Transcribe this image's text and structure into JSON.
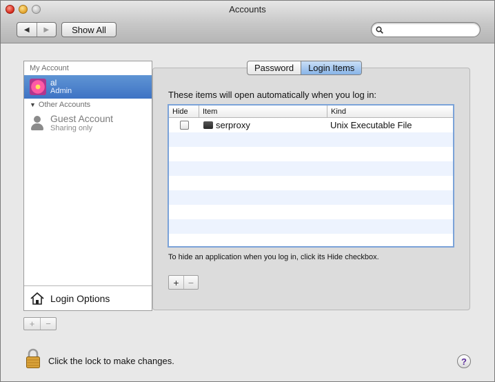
{
  "window": {
    "title": "Accounts"
  },
  "toolbar": {
    "back_glyph": "◀",
    "forward_glyph": "▶",
    "show_all_label": "Show All",
    "search_value": ""
  },
  "sidebar": {
    "my_account_header": "My Account",
    "my_account": {
      "name": "al",
      "role": "Admin"
    },
    "other_accounts_header": "Other Accounts",
    "other_accounts": [
      {
        "name": "Guest Account",
        "role": "Sharing only"
      }
    ],
    "login_options_label": "Login Options",
    "add_glyph": "+",
    "remove_glyph": "−"
  },
  "tabs": [
    {
      "label": "Password",
      "active": false
    },
    {
      "label": "Login Items",
      "active": true
    }
  ],
  "login_items": {
    "intro": "These items will open automatically when you log in:",
    "columns": {
      "hide": "Hide",
      "item": "Item",
      "kind": "Kind"
    },
    "rows": [
      {
        "hidden": false,
        "item": "serproxy",
        "kind": "Unix Executable File"
      }
    ],
    "hint": "To hide an application when you log in, click its Hide checkbox.",
    "add_glyph": "+",
    "remove_glyph": "−"
  },
  "footer": {
    "lock_text": "Click the lock to make changes.",
    "help_glyph": "?"
  },
  "colors": {
    "selection": "#3e73c4",
    "active_tab": "#88b4e8",
    "table_focus": "#7aa2d8",
    "stripe": "#edf3fe"
  }
}
